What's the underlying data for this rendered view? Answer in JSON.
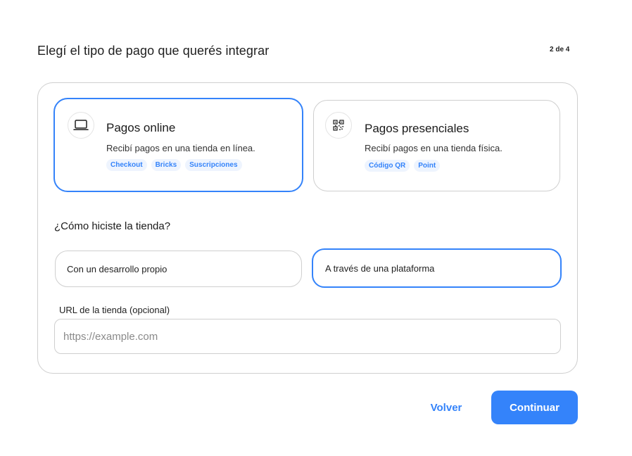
{
  "header": {
    "title": "Elegí el tipo de pago que querés integrar",
    "step": "2 de 4"
  },
  "payment_types": [
    {
      "title": "Pagos online",
      "description": "Recibí pagos en una tienda en línea.",
      "icon": "laptop-icon",
      "selected": true,
      "tags": [
        "Checkout",
        "Bricks",
        "Suscripciones"
      ]
    },
    {
      "title": "Pagos presenciales",
      "description": "Recibí pagos en una tienda física.",
      "icon": "qr-code-icon",
      "selected": false,
      "tags": [
        "Código QR",
        "Point"
      ]
    }
  ],
  "store_question": {
    "label": "¿Cómo hiciste la tienda?",
    "options": [
      {
        "label": "Con un desarrollo propio",
        "selected": false
      },
      {
        "label": "A través de una plataforma",
        "selected": true
      }
    ]
  },
  "store_url": {
    "label": "URL de la tienda (opcional)",
    "value": "",
    "placeholder": "https://example.com"
  },
  "actions": {
    "back_label": "Volver",
    "continue_label": "Continuar"
  },
  "colors": {
    "accent": "#3483fa",
    "tag_background": "#eef4fe",
    "border": "#cfcfcf"
  }
}
